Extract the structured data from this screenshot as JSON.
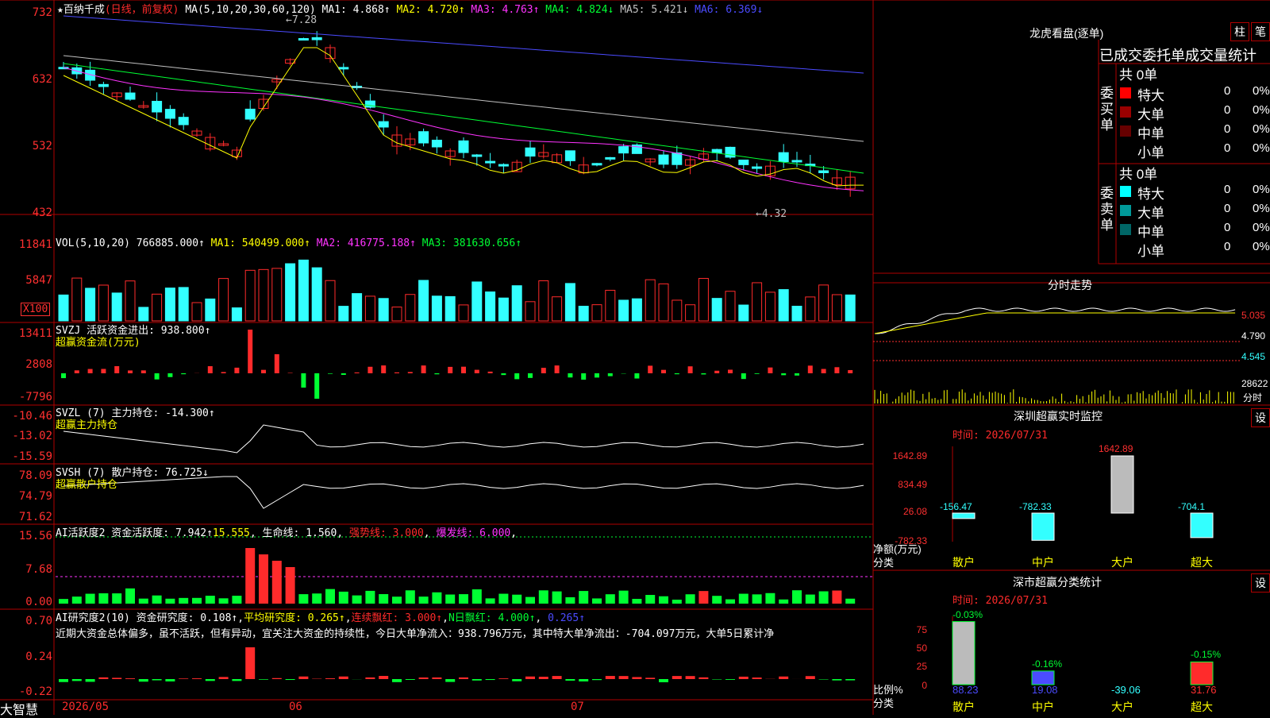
{
  "header": {
    "stock_name": "★百纳千成",
    "period": "(日线，前复权)",
    "ma_params": "MA(5,10,20,30,60,120)",
    "ma1": "MA1: 4.868↑",
    "ma2": "MA2: 4.720↑",
    "ma3": "MA3: 4.763↑",
    "ma4": "MA4: 4.824↓",
    "ma5": "MA5: 5.421↓",
    "ma6": "MA6: 6.369↓",
    "high_mark": "7.28",
    "low_mark": "4.32"
  },
  "price_axis": [
    "732",
    "632",
    "532",
    "432"
  ],
  "vol": {
    "title": "VOL(5,10,20)",
    "val": "766885.000↑",
    "ma1": "MA1: 540499.000↑",
    "ma2": "MA2: 416775.188↑",
    "ma3": "MA3: 381630.656↑",
    "axis": [
      "11841",
      "5847",
      "X100"
    ]
  },
  "svzj": {
    "title": "SVZJ  活跃资金进出: 938.800↑",
    "subtitle": "超赢资金流(万元)",
    "axis": [
      "13411",
      "2808",
      "-7796"
    ]
  },
  "svzl": {
    "title": "SVZL (7) 主力持仓: -14.300↑",
    "subtitle": "超赢主力持仓",
    "axis": [
      "-10.46",
      "-13.02",
      "-15.59"
    ]
  },
  "svsh": {
    "title": "SVSH (7) 散户持仓: 76.725↓",
    "subtitle": "超赢散户持仓",
    "axis": [
      "78.09",
      "74.79",
      "71.62"
    ]
  },
  "ai1": {
    "title": "AI活跃度2 资金活跃度: 7.942↑",
    "v2": "15.555",
    "life": "生命线: 1.560",
    "strong": "强势线: 3.000",
    "burst": "爆发线: 6.000",
    "axis": [
      "15.56",
      "7.68",
      "0.00"
    ]
  },
  "ai2": {
    "title": "AI研究度2(10) 资金研究度: 0.108↑",
    "avg": "平均研究度: 0.265↑",
    "red": "连续飘红: 3.000↑",
    "nred": "N日飘红: 4.000↑",
    "last": "0.265↑",
    "comment": "近期大资金总体偏多，虽不活跃，但有异动，宜关注大资金的持续性，今日大单净流入：938.796万元，其中特大单净流出：-704.097万元，大单5日累计净",
    "axis": [
      "0.70",
      "0.24",
      "-0.22"
    ]
  },
  "dates": [
    "2026/05",
    "06",
    "07"
  ],
  "brand": "大智慧",
  "right": {
    "longhu_title": "龙虎看盘(逐单)",
    "btn_bar": "柱",
    "btn_pen": "笔",
    "tabs": "已成交委托单成交量统计",
    "buy_label": "委买单",
    "sell_label": "委卖单",
    "buy_total": "共 0单",
    "sell_total": "共 0单",
    "buy_rows": [
      {
        "name": "特大",
        "n": "0",
        "pct": "0%",
        "color": "#ff0000"
      },
      {
        "name": "大单",
        "n": "0",
        "pct": "0%",
        "color": "#990000"
      },
      {
        "name": "中单",
        "n": "0",
        "pct": "0%",
        "color": "#660000"
      },
      {
        "name": "小单",
        "n": "0",
        "pct": "0%",
        "color": ""
      }
    ],
    "sell_rows": [
      {
        "name": "特大",
        "n": "0",
        "pct": "0%",
        "color": "#00ffff"
      },
      {
        "name": "大单",
        "n": "0",
        "pct": "0%",
        "color": "#009999"
      },
      {
        "name": "中单",
        "n": "0",
        "pct": "0%",
        "color": "#006666"
      },
      {
        "name": "小单",
        "n": "0",
        "pct": "0%",
        "color": ""
      }
    ],
    "intraday_title": "分时走势",
    "intraday_axis": [
      "5.035",
      "4.790",
      "4.545"
    ],
    "intraday_vol": "28622",
    "intraday_tag": "分时",
    "sz_title": "深圳超赢实时监控",
    "sz_btn": "设",
    "sz_time": "时间: 2026/07/31",
    "sz_axis": [
      "1642.89",
      "834.49",
      "26.08",
      "-782.33"
    ],
    "sz_bars": [
      {
        "label": "散户",
        "value": "-156.47"
      },
      {
        "label": "中户",
        "value": "-782.33"
      },
      {
        "label": "大户",
        "value": "1642.89"
      },
      {
        "label": "超大",
        "value": "-704.1"
      }
    ],
    "sz_ylabel": "净额(万元)",
    "sz_xlabel": "分类",
    "cls_title": "深市超赢分类统计",
    "cls_btn": "设",
    "cls_time": "时间: 2026/07/31",
    "cls_axis": [
      "75",
      "50",
      "25",
      "0"
    ],
    "cls_bars": [
      {
        "label": "散户",
        "pct": "-0.03%",
        "value": "88.23"
      },
      {
        "label": "中户",
        "pct": "-0.16%",
        "value": "19.08"
      },
      {
        "label": "大户",
        "pct": "",
        "value": "-39.06"
      },
      {
        "label": "超大",
        "pct": "-0.15%",
        "value": "31.76"
      }
    ],
    "cls_ylabel": "比例%",
    "cls_xlabel": "分类"
  }
}
